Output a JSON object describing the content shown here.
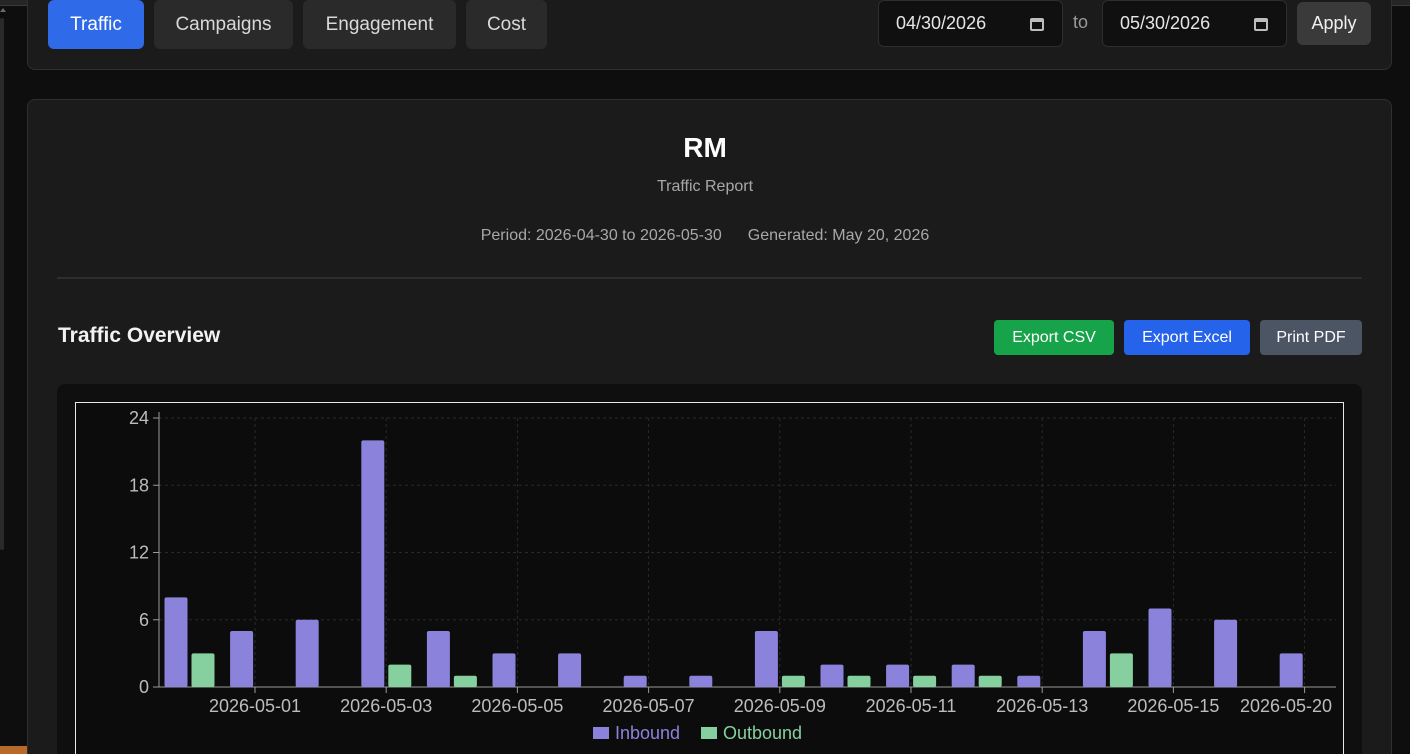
{
  "tabs": [
    {
      "label": "Traffic",
      "active": true
    },
    {
      "label": "Campaigns",
      "active": false
    },
    {
      "label": "Engagement",
      "active": false
    },
    {
      "label": "Cost",
      "active": false
    }
  ],
  "date_range": {
    "start": "04/30/2026",
    "to_label": "to",
    "end": "05/30/2026",
    "apply_label": "Apply"
  },
  "report": {
    "title": "RM",
    "subtitle": "Traffic Report",
    "period": "Period: 2026-04-30 to 2026-05-30",
    "generated": "Generated: May 20, 2026"
  },
  "section": {
    "title": "Traffic Overview",
    "export_csv": "Export CSV",
    "export_excel": "Export Excel",
    "print_pdf": "Print PDF"
  },
  "colors": {
    "accent": "#2f6be9",
    "csv_button": "#16a34a",
    "excel_button": "#2563eb",
    "pdf_button": "#4b5563",
    "inbound": "#8b82dc",
    "outbound": "#86d0a0"
  },
  "chart_data": {
    "type": "bar",
    "categories": [
      "2026-04-30",
      "2026-05-01",
      "2026-05-02",
      "2026-05-03",
      "2026-05-04",
      "2026-05-05",
      "2026-05-06",
      "2026-05-07",
      "2026-05-08",
      "2026-05-09",
      "2026-05-10",
      "2026-05-11",
      "2026-05-12",
      "2026-05-13",
      "2026-05-14",
      "2026-05-15",
      "2026-05-16",
      "2026-05-17",
      "2026-05-18"
    ],
    "series": [
      {
        "name": "Inbound",
        "values": [
          8,
          5,
          6,
          22,
          5,
          3,
          3,
          1,
          1,
          5,
          2,
          2,
          2,
          1,
          5,
          7,
          6,
          3,
          0
        ]
      },
      {
        "name": "Outbound",
        "values": [
          3,
          0,
          0,
          2,
          1,
          0,
          0,
          0,
          0,
          1,
          1,
          1,
          1,
          0,
          3,
          0,
          0,
          0,
          0
        ]
      }
    ],
    "x_tick_labels": [
      "2026-05-01",
      "2026-05-03",
      "2026-05-05",
      "2026-05-07",
      "2026-05-09",
      "2026-05-11",
      "2026-05-13",
      "2026-05-15",
      "2026-05-20"
    ],
    "y_ticks": [
      0,
      6,
      12,
      18,
      24
    ],
    "ylim": [
      0,
      24
    ],
    "grid": true,
    "legend": "bottom-center"
  }
}
